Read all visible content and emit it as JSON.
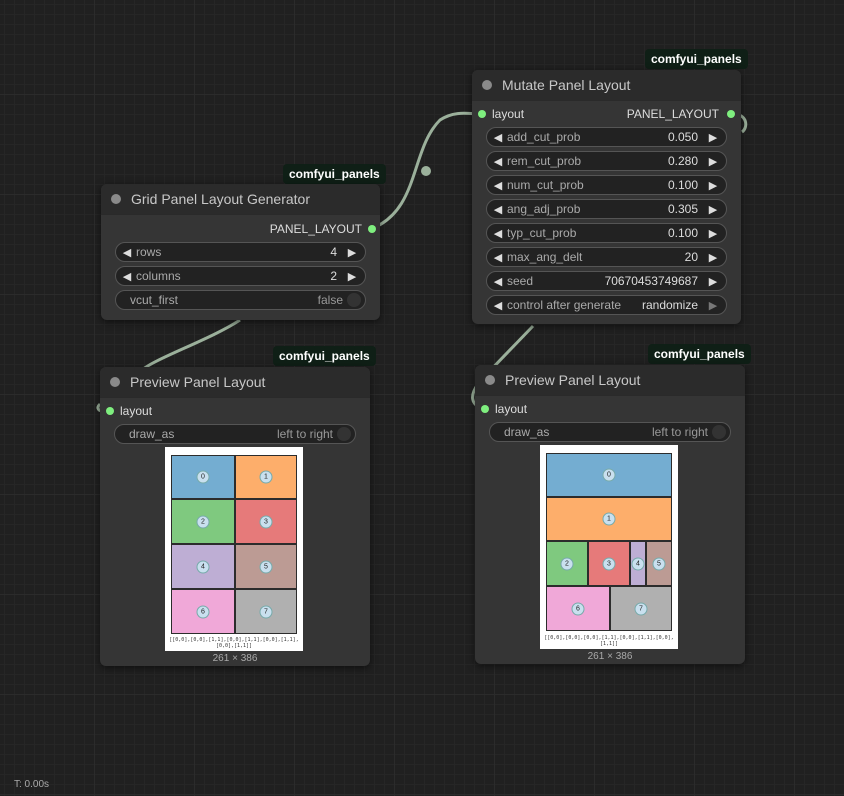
{
  "badges": {
    "mutate": "comfyui_panels",
    "grid": "comfyui_panels",
    "preview_left": "comfyui_panels",
    "preview_right": "comfyui_panels"
  },
  "grid_node": {
    "title": "Grid Panel Layout Generator",
    "output": "PANEL_LAYOUT",
    "widgets": [
      {
        "name": "rows",
        "value": "4"
      },
      {
        "name": "columns",
        "value": "2"
      }
    ],
    "toggle": {
      "name": "vcut_first",
      "value": "false"
    }
  },
  "mutate_node": {
    "title": "Mutate Panel Layout",
    "input": "layout",
    "output": "PANEL_LAYOUT",
    "widgets": [
      {
        "name": "add_cut_prob",
        "value": "0.050"
      },
      {
        "name": "rem_cut_prob",
        "value": "0.280"
      },
      {
        "name": "num_cut_prob",
        "value": "0.100"
      },
      {
        "name": "ang_adj_prob",
        "value": "0.305"
      },
      {
        "name": "typ_cut_prob",
        "value": "0.100"
      },
      {
        "name": "max_ang_delt",
        "value": "20"
      },
      {
        "name": "seed",
        "value": "70670453749687"
      },
      {
        "name": "control after generate",
        "value": "randomize"
      }
    ]
  },
  "preview_left": {
    "title": "Preview Panel Layout",
    "input": "layout",
    "toggle": {
      "name": "draw_as",
      "value": "left to right"
    },
    "cells": [
      "0",
      "1",
      "2",
      "3",
      "4",
      "5",
      "6",
      "7"
    ],
    "caption": "[[0,0],[0,0],[1,1],[0,0],[1,1],[0,0],[1,1],[0,0],[1,1]]",
    "dims": "261 × 386",
    "colors": [
      "#74add1",
      "#fdae6b",
      "#7fc97f",
      "#e67a7a",
      "#beaed4",
      "#bc9b94",
      "#f0a8d8",
      "#b0b0b0"
    ]
  },
  "preview_right": {
    "title": "Preview Panel Layout",
    "input": "layout",
    "toggle": {
      "name": "draw_as",
      "value": "left to right"
    },
    "cells": [
      "0",
      "1",
      "2",
      "3",
      "4",
      "5",
      "6",
      "7"
    ],
    "caption": "[[0,0],[0,0],[0,0],[1,1],[0,0],[1,1],[0,0],[1,1]]",
    "dims": "261 × 386",
    "colors": [
      "#74add1",
      "#fdae6b",
      "#7fc97f",
      "#e67a7a",
      "#beaed4",
      "#bc9b94",
      "#f0a8d8",
      "#b0b0b0"
    ]
  },
  "status": {
    "timer": "T: 0.00s"
  }
}
